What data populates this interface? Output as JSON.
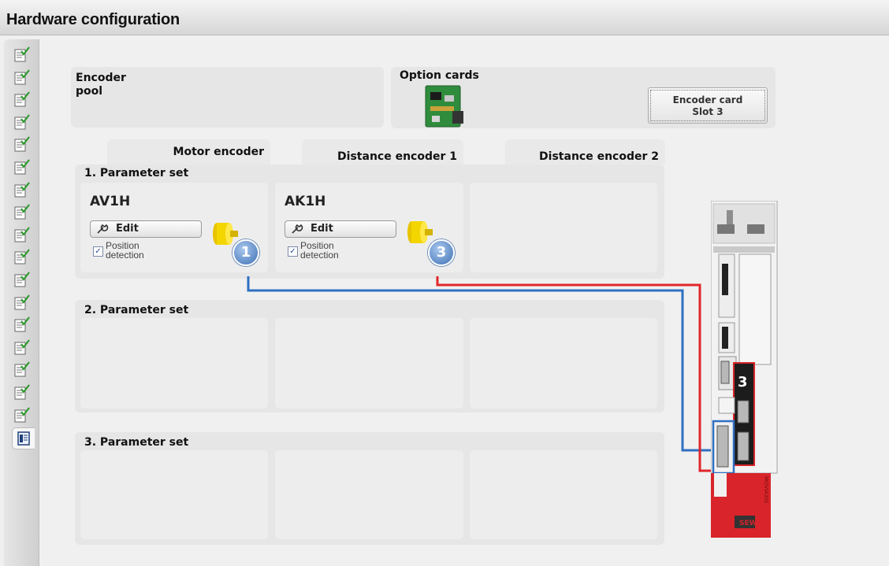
{
  "title": "Hardware configuration",
  "sidebar": {
    "count_check": 17
  },
  "encoder_pool": {
    "label": "Encoder\npool"
  },
  "option_cards": {
    "label": "Option cards",
    "button": {
      "line1": "Encoder card",
      "line2": "Slot 3"
    }
  },
  "tabs": [
    "Motor encoder",
    "Distance encoder 1",
    "Distance encoder 2"
  ],
  "parameter_sets": [
    {
      "label": "1. Parameter set",
      "cells": [
        {
          "name": "AV1H",
          "edit": "Edit",
          "position_detection": "Position\ndetection",
          "checked": true,
          "badge": "1"
        },
        {
          "name": "AK1H",
          "edit": "Edit",
          "position_detection": "Position\ndetection",
          "checked": true,
          "badge": "3"
        },
        null
      ]
    },
    {
      "label": "2. Parameter set",
      "cells": [
        null,
        null,
        null
      ]
    },
    {
      "label": "3. Parameter set",
      "cells": [
        null,
        null,
        null
      ]
    }
  ],
  "device": {
    "slot_label": "3",
    "brand": "SEW",
    "model_text": "MOVIAXIS"
  },
  "colors": {
    "blue_line": "#2f6fc2",
    "red_line": "#e0262a",
    "device_red": "#d8242a"
  }
}
